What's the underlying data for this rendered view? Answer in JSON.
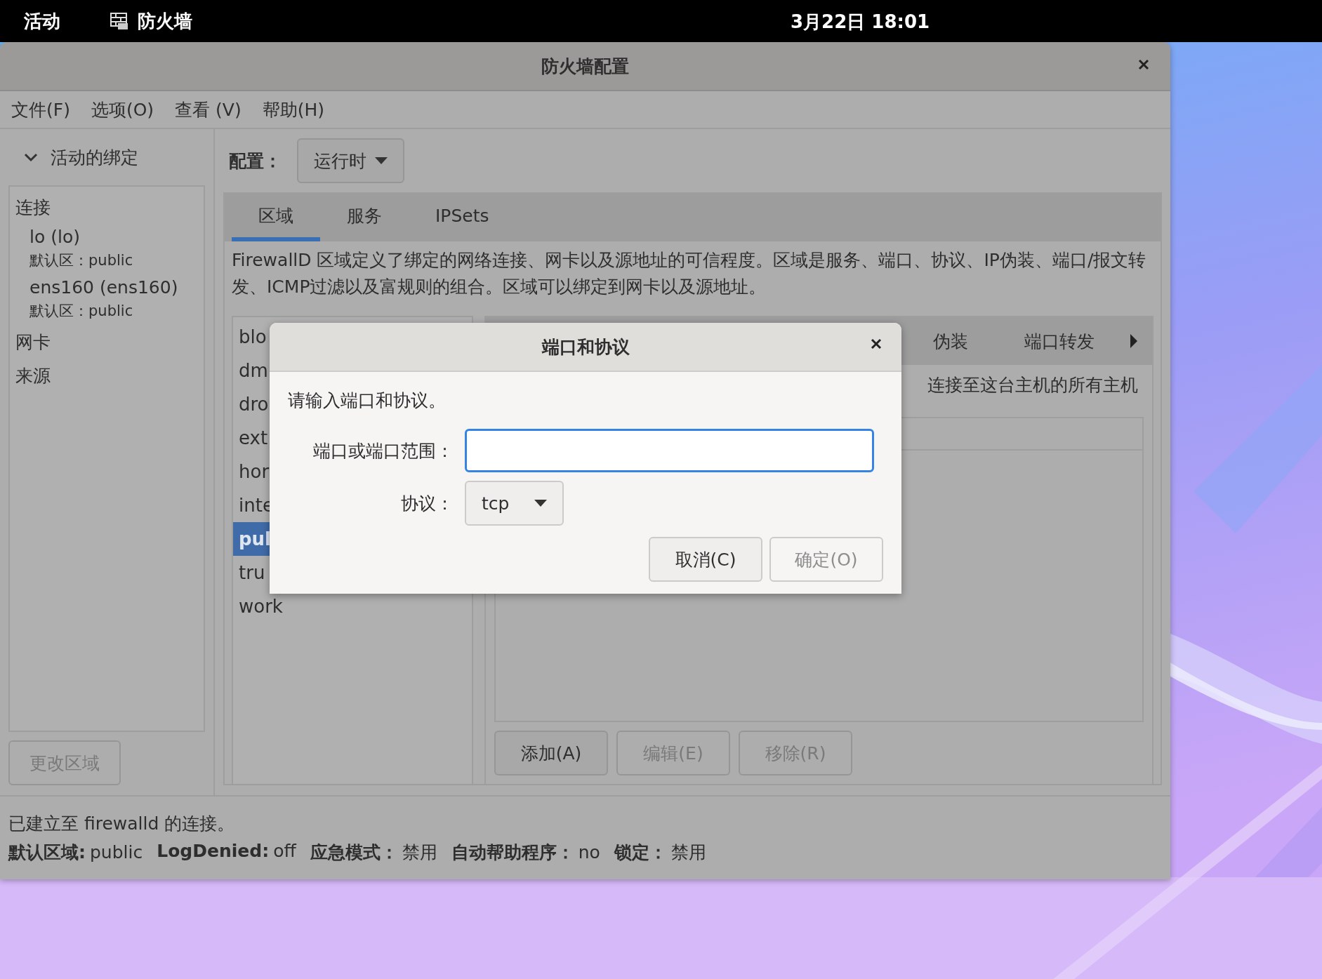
{
  "top_bar": {
    "activities": "活动",
    "app_name": "防火墙",
    "clock": "3月22日  18:01"
  },
  "window": {
    "title": "防火墙配置"
  },
  "menu": [
    "文件(F)",
    "选项(O)",
    "查看 (V)",
    "帮助(H)"
  ],
  "sidebar": {
    "header": "活动的绑定",
    "expanded": true,
    "sections": [
      {
        "label": "连接",
        "items": [
          {
            "name": "lo (lo)",
            "detail": "默认区：public"
          },
          {
            "name": "ens160 (ens160)",
            "detail": "默认区：public"
          }
        ]
      },
      {
        "label": "网卡"
      },
      {
        "label": "来源"
      }
    ],
    "button": {
      "label": "更改区域",
      "disabled": true
    }
  },
  "config": {
    "label": "配置：",
    "value": "运行时"
  },
  "tabs": [
    {
      "label": "区域",
      "selected": true
    },
    {
      "label": "服务",
      "selected": false
    },
    {
      "label": "IPSets",
      "selected": false
    }
  ],
  "description": "FirewallD 区域定义了绑定的网络连接、网卡以及源地址的可信程度。区域是服务、端口、协议、IP伪装、端口/报文转发、ICMP过滤以及富规则的组合。区域可以绑定到网卡以及源地址。",
  "zones": [
    {
      "name": "blo",
      "selected": false
    },
    {
      "name": "dm",
      "selected": false
    },
    {
      "name": "dro",
      "selected": false
    },
    {
      "name": "ext",
      "selected": false
    },
    {
      "name": "hor",
      "selected": false
    },
    {
      "name": "inte",
      "selected": false
    },
    {
      "name": "pul",
      "selected": true
    },
    {
      "name": "tru",
      "selected": false
    },
    {
      "name": "work",
      "selected": false
    }
  ],
  "zone_tabs": [
    {
      "label": "伪装"
    },
    {
      "label": "端口转发"
    }
  ],
  "zone_description": "连接至这台主机的所有主机",
  "zone_buttons": [
    {
      "label": "添加(A)",
      "disabled": false
    },
    {
      "label": "编辑(E)",
      "disabled": true
    },
    {
      "label": "移除(R)",
      "disabled": true
    }
  ],
  "status_bar": {
    "message": "已建立至 firewalld 的连接。",
    "items": [
      {
        "label": "默认区域:",
        "value": "public"
      },
      {
        "label": "LogDenied:",
        "value": "off"
      },
      {
        "label": "应急模式：",
        "value": "禁用"
      },
      {
        "label": "自动帮助程序：",
        "value": "no"
      },
      {
        "label": "锁定：",
        "value": "禁用"
      }
    ]
  },
  "dialog": {
    "title": "端口和协议",
    "prompt": "请输入端口和协议。",
    "fields": [
      {
        "kind": "text",
        "label": "端口或端口范围：",
        "focused": true
      },
      {
        "kind": "dropdown",
        "label": "协议：",
        "value": "tcp"
      }
    ],
    "buttons": [
      {
        "label": "取消(C)",
        "disabled": false
      },
      {
        "label": "确定(O)",
        "disabled": true
      }
    ]
  }
}
